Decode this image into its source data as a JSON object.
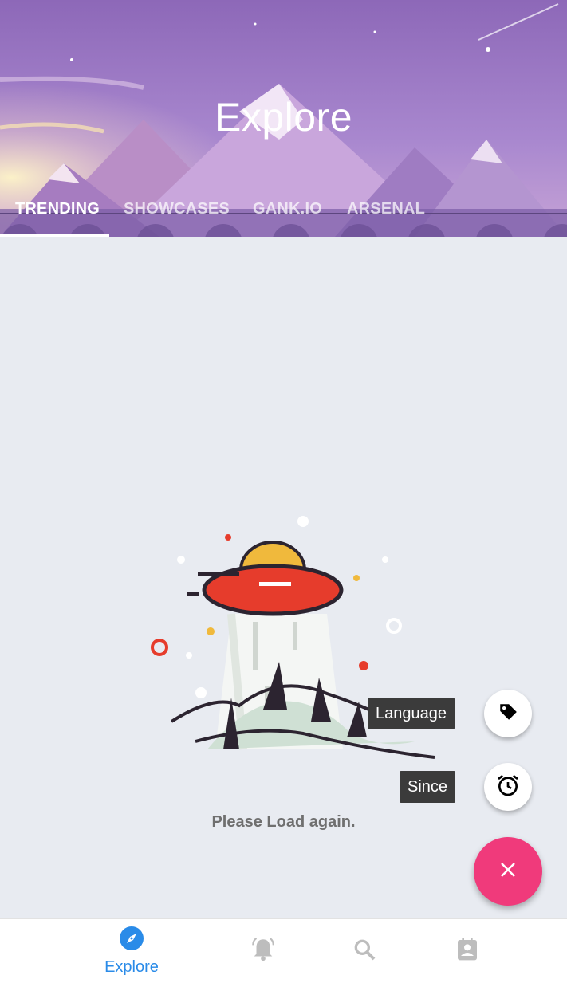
{
  "header": {
    "title": "Explore",
    "tabs": [
      {
        "label": "TRENDING",
        "active": true
      },
      {
        "label": "SHOWCASES",
        "active": false
      },
      {
        "label": "GANK.IO",
        "active": false
      },
      {
        "label": "ARSENAL",
        "active": false
      }
    ]
  },
  "empty_state": {
    "illustration": "ufo-illustration",
    "message": "Please Load again."
  },
  "fab_menu": {
    "language_label": "Language",
    "language_icon": "tag-icon",
    "since_label": "Since",
    "since_icon": "alarm-clock-icon",
    "main_icon": "close-icon",
    "main_color": "#f03a7b"
  },
  "bottom_nav": {
    "items": [
      {
        "label": "Explore",
        "icon": "compass-icon",
        "active": true
      },
      {
        "icon": "bell-icon",
        "active": false
      },
      {
        "icon": "search-icon",
        "active": false
      },
      {
        "icon": "profile-card-icon",
        "active": false
      }
    ],
    "accent": "#2a8be8",
    "inactive_color": "#bdbdbd"
  }
}
